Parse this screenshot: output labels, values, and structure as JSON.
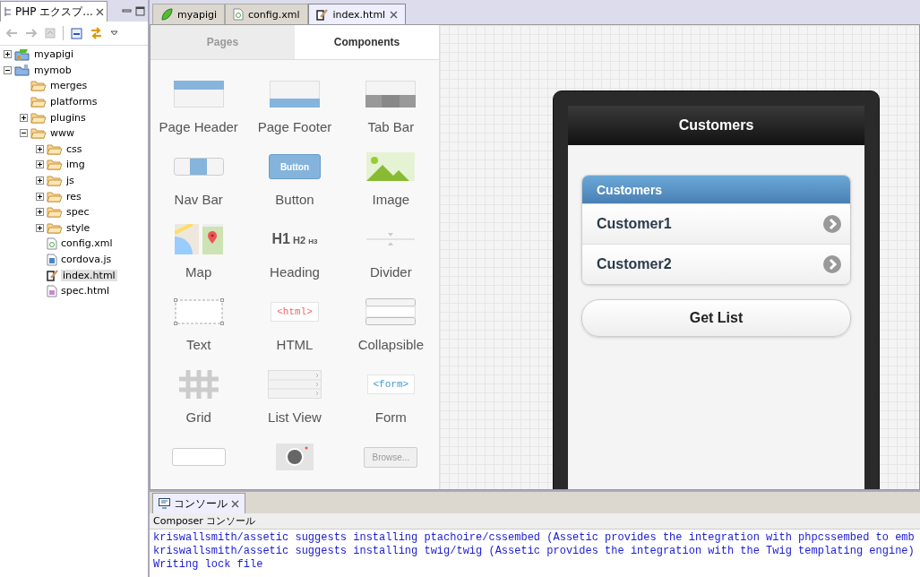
{
  "explorer": {
    "tab": {
      "label": "PHP エクスプ...",
      "selected": true
    },
    "tree": [
      {
        "label": "myapigi",
        "kind": "project",
        "expanded": false,
        "selected": false
      },
      {
        "label": "mymob",
        "kind": "project-js",
        "expanded": true,
        "selected": false,
        "children": [
          {
            "label": "merges",
            "kind": "folder",
            "selected": false
          },
          {
            "label": "platforms",
            "kind": "folder",
            "selected": false
          },
          {
            "label": "plugins",
            "kind": "folder",
            "expanded": false,
            "selected": false
          },
          {
            "label": "www",
            "kind": "folder",
            "expanded": true,
            "selected": false,
            "children": [
              {
                "label": "css",
                "kind": "folder",
                "expanded": false,
                "selected": false
              },
              {
                "label": "img",
                "kind": "folder",
                "expanded": false,
                "selected": false
              },
              {
                "label": "js",
                "kind": "folder",
                "expanded": false,
                "selected": false
              },
              {
                "label": "res",
                "kind": "folder",
                "expanded": false,
                "selected": false
              },
              {
                "label": "spec",
                "kind": "folder",
                "expanded": false,
                "selected": false
              },
              {
                "label": "style",
                "kind": "folder",
                "expanded": false,
                "selected": false
              },
              {
                "label": "config.xml",
                "kind": "xml",
                "selected": false
              },
              {
                "label": "cordova.js",
                "kind": "js",
                "selected": false
              },
              {
                "label": "index.html",
                "kind": "page",
                "selected": true
              },
              {
                "label": "spec.html",
                "kind": "html",
                "selected": false
              }
            ]
          }
        ]
      }
    ]
  },
  "editor_tabs": [
    {
      "label": "myapigi",
      "kind": "leaf",
      "selected": false
    },
    {
      "label": "config.xml",
      "kind": "xml",
      "selected": false
    },
    {
      "label": "index.html",
      "kind": "page",
      "selected": true
    }
  ],
  "palette": {
    "tabs": [
      {
        "label": "Pages",
        "selected": false
      },
      {
        "label": "Components",
        "selected": true
      }
    ],
    "components": [
      {
        "label": "Page Header",
        "kind": "header"
      },
      {
        "label": "Page Footer",
        "kind": "footer"
      },
      {
        "label": "Tab Bar",
        "kind": "tabbar"
      },
      {
        "label": "Nav Bar",
        "kind": "navbar"
      },
      {
        "label": "Button",
        "kind": "button",
        "preview": "Button"
      },
      {
        "label": "Image",
        "kind": "image"
      },
      {
        "label": "Map",
        "kind": "map"
      },
      {
        "label": "Heading",
        "kind": "heading",
        "preview": [
          "H1",
          "H2",
          "H3"
        ]
      },
      {
        "label": "Divider",
        "kind": "divider"
      },
      {
        "label": "Text",
        "kind": "text"
      },
      {
        "label": "HTML",
        "kind": "html",
        "preview": "<html>"
      },
      {
        "label": "Collapsible",
        "kind": "collapsible"
      },
      {
        "label": "Grid",
        "kind": "grid"
      },
      {
        "label": "List View",
        "kind": "listview"
      },
      {
        "label": "Form",
        "kind": "form",
        "preview": "<form>"
      },
      {
        "kind": "input"
      },
      {
        "kind": "camera"
      },
      {
        "kind": "file",
        "preview": "Browse..."
      }
    ]
  },
  "phone": {
    "title": "Customers",
    "list": {
      "header": "Customers",
      "items": [
        "Customer1",
        "Customer2"
      ]
    },
    "button": "Get List"
  },
  "console": {
    "tab": "コンソール",
    "title": "Composer コンソール",
    "lines": [
      "kriswallsmith/assetic suggests installing ptachoire/cssembed (Assetic provides the integration with phpcssembed to emb",
      "kriswallsmith/assetic suggests installing twig/twig (Assetic provides the integration with the Twig templating engine)",
      "Writing lock file"
    ]
  }
}
